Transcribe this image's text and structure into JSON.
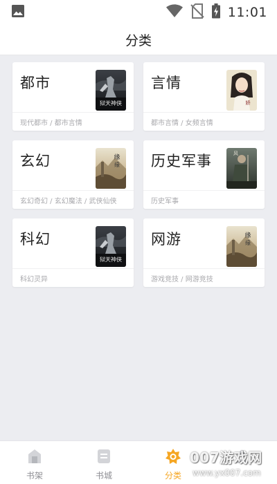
{
  "status_bar": {
    "time": "11:01",
    "icons": [
      "image-icon",
      "wifi-icon",
      "no-sim-icon",
      "battery-charging-icon"
    ]
  },
  "header": {
    "title": "分类"
  },
  "categories": [
    {
      "title": "都市",
      "subtitle": "现代都市 / 都市言情",
      "cover_icon": "book-cover-warrior"
    },
    {
      "title": "言情",
      "subtitle": "都市言情 / 女频言情",
      "cover_icon": "book-cover-woman"
    },
    {
      "title": "玄幻",
      "subtitle": "玄幻奇幻 / 玄幻魔法 / 武侠仙侠",
      "cover_icon": "book-cover-landscape"
    },
    {
      "title": "历史军事",
      "subtitle": "历史军事",
      "cover_icon": "book-cover-soldier"
    },
    {
      "title": "科幻",
      "subtitle": "科幻灵异",
      "cover_icon": "book-cover-warrior"
    },
    {
      "title": "网游",
      "subtitle": "游戏竞技 / 网游竞技",
      "cover_icon": "book-cover-landscape"
    }
  ],
  "bottom_nav": [
    {
      "label": "书架",
      "icon": "bookshelf-icon",
      "active": false
    },
    {
      "label": "书城",
      "icon": "bookstore-icon",
      "active": false
    },
    {
      "label": "分类",
      "icon": "category-icon",
      "active": true
    },
    {
      "label": "",
      "icon": "user-icon",
      "active": false
    }
  ],
  "watermark": {
    "text": "007游戏网",
    "url": "www.yx007.com"
  },
  "colors": {
    "accent": "#f5a623",
    "background": "#ecedf1",
    "card": "#ffffff"
  }
}
